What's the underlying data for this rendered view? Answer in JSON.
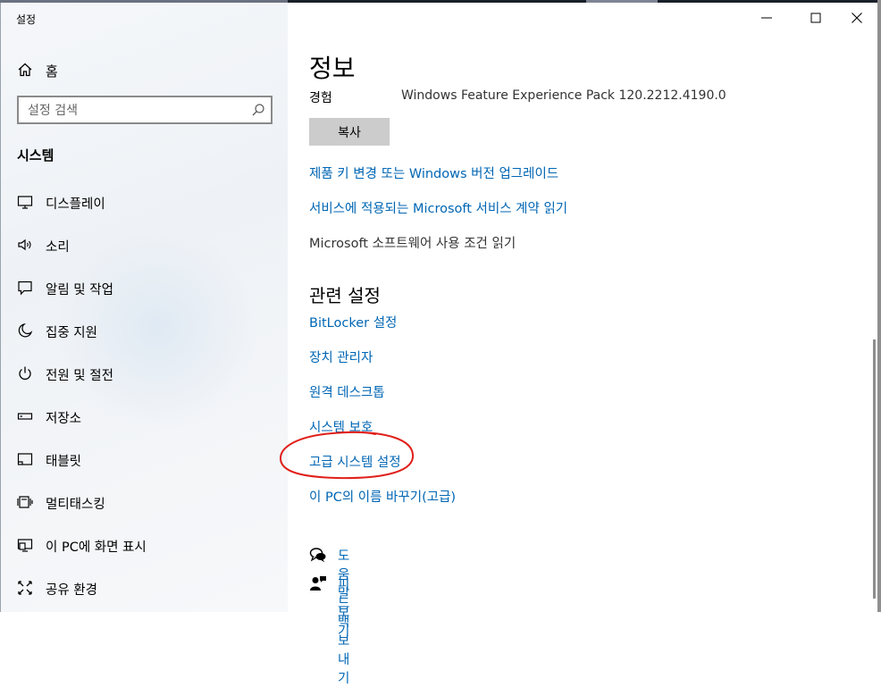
{
  "window": {
    "title": "설정"
  },
  "sidebar": {
    "home_label": "홈",
    "search_placeholder": "설정 검색",
    "section_title": "시스템",
    "items": [
      {
        "label": "디스플레이",
        "icon": "monitor-icon"
      },
      {
        "label": "소리",
        "icon": "speaker-icon"
      },
      {
        "label": "알림 및 작업",
        "icon": "notification-icon"
      },
      {
        "label": "집중 지원",
        "icon": "moon-icon"
      },
      {
        "label": "전원 및 절전",
        "icon": "power-icon"
      },
      {
        "label": "저장소",
        "icon": "storage-icon"
      },
      {
        "label": "태블릿",
        "icon": "tablet-icon"
      },
      {
        "label": "멀티태스킹",
        "icon": "multitasking-icon"
      },
      {
        "label": "이 PC에 화면 표시",
        "icon": "project-icon"
      },
      {
        "label": "공유 환경",
        "icon": "shared-experiences-icon"
      }
    ]
  },
  "main": {
    "page_title": "정보",
    "experience": {
      "label": "경험",
      "value": "Windows Feature Experience Pack 120.2212.4190.0"
    },
    "copy_label": "복사",
    "links": [
      "제품 키 변경 또는 Windows 버전 업그레이드",
      "서비스에 적용되는 Microsoft 서비스 계약 읽기"
    ],
    "license_text": "Microsoft 소프트웨어 사용 조건 읽기",
    "related_title": "관련 설정",
    "related_links": [
      "BitLocker 설정",
      "장치 관리자",
      "원격 데스크톱",
      "시스템 보호",
      "고급 시스템 설정",
      "이 PC의 이름 바꾸기(고급)"
    ],
    "help_label": "도움말 보기",
    "feedback_label": "피드백 보내기"
  },
  "colors": {
    "link": "#0066b4",
    "annotation": "#e0201a",
    "button": "#cccccc"
  }
}
